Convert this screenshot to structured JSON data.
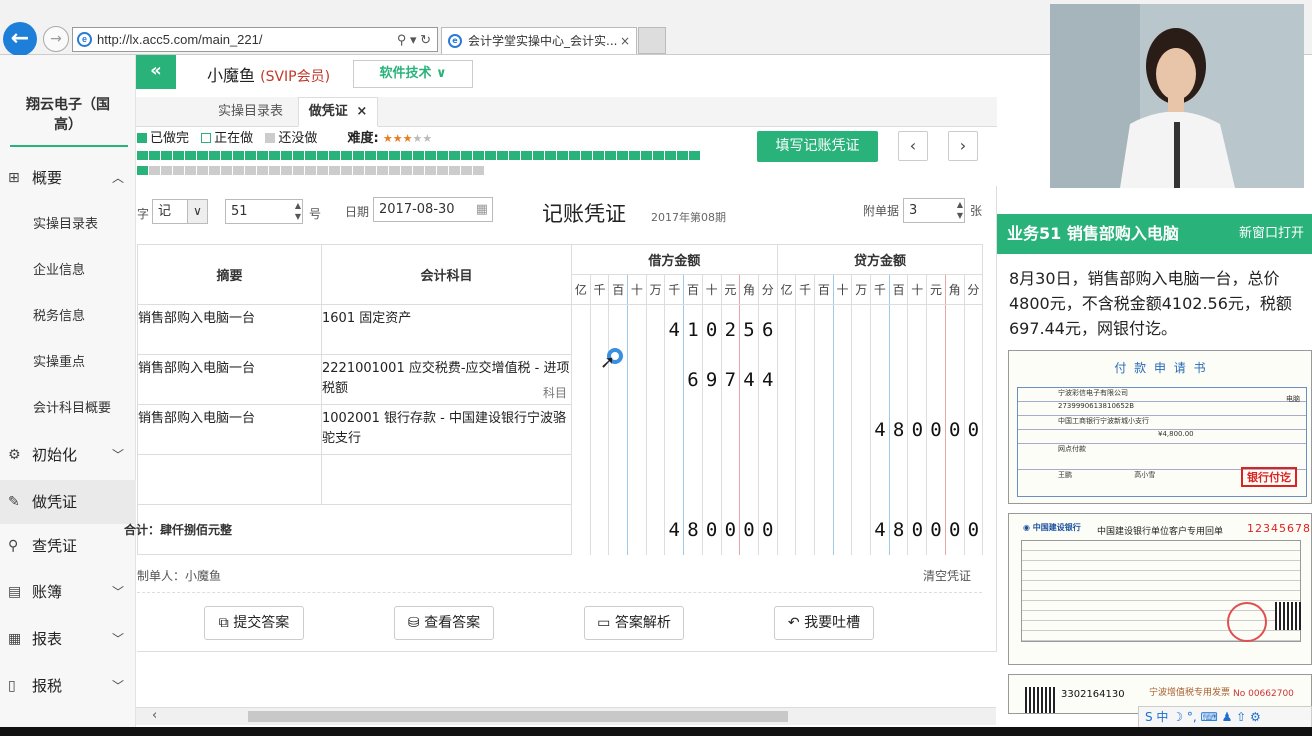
{
  "browser": {
    "url": "http://lx.acc5.com/main_221/",
    "tab_title": "会计学堂实操中心_会计实...",
    "tab_close": "×"
  },
  "sidebar": {
    "org_name": "翔云电子（国高）",
    "sections": [
      {
        "label": "概要",
        "icon": "grid-icon",
        "expanded": true,
        "items": [
          "实操目录表",
          "企业信息",
          "税务信息",
          "实操重点",
          "会计科目概要"
        ]
      },
      {
        "label": "初始化",
        "icon": "gear-icon"
      },
      {
        "label": "做凭证",
        "icon": "pencil-icon",
        "active": true
      },
      {
        "label": "查凭证",
        "icon": "search-icon"
      },
      {
        "label": "账簿",
        "icon": "book-icon"
      },
      {
        "label": "报表",
        "icon": "report-icon"
      },
      {
        "label": "报税",
        "icon": "document-icon"
      }
    ]
  },
  "header": {
    "collapse": "«",
    "username": "小魔鱼",
    "vip": "(SVIP会员)",
    "software_button": "软件技术 ∨"
  },
  "tabs": [
    {
      "label": "实操目录表"
    },
    {
      "label": "做凭证",
      "close": "×"
    }
  ],
  "legend": {
    "done": "已做完",
    "doing": "正在做",
    "todo": "还没做",
    "difficulty_label": "难度:",
    "difficulty": 3,
    "difficulty_max": 5,
    "done_color": "#2ab27b"
  },
  "progress": {
    "done_count": 48,
    "total": 76
  },
  "fill_button": "填写记账凭证",
  "prev_button": "‹",
  "next_button": "›",
  "voucher": {
    "zi_label": "字",
    "zi_value": "记",
    "number": "51",
    "hao_label": "号",
    "date_label": "日期",
    "date": "2017-08-30",
    "title": "记账凭证",
    "period": "2017年第08期",
    "attach_label": "附单据",
    "attach_count": "3",
    "attach_unit": "张",
    "col_summary": "摘要",
    "col_account": "会计科目",
    "col_debit": "借方金额",
    "col_credit": "贷方金额",
    "digit_units": [
      "亿",
      "千",
      "百",
      "十",
      "万",
      "千",
      "百",
      "十",
      "元",
      "角",
      "分"
    ],
    "rows": [
      {
        "summary": "销售部购入电脑一台",
        "account": "1601 固定资产",
        "debit": "410256",
        "credit": ""
      },
      {
        "summary": "销售部购入电脑一台",
        "account": "2221001001 应交税费-应交增值税 - 进项税额",
        "account_hint": "科目",
        "debit": "69744",
        "credit": ""
      },
      {
        "summary": "销售部购入电脑一台",
        "account": "1002001 银行存款 - 中国建设银行宁波骆驼支行",
        "debit": "",
        "credit": "480000"
      },
      {
        "summary": "",
        "account": "",
        "debit": "",
        "credit": ""
      }
    ],
    "total_label": "合计：肆仟捌佰元整",
    "total_debit": "480000",
    "total_credit": "480000",
    "maker": "制单人：小魔鱼",
    "clear": "清空凭证"
  },
  "actions": [
    {
      "icon": "external-link-icon",
      "label": "提交答案"
    },
    {
      "icon": "database-icon",
      "label": "查看答案"
    },
    {
      "icon": "folder-open-icon",
      "label": "答案解析"
    },
    {
      "icon": "reply-icon",
      "label": "我要吐槽"
    }
  ],
  "business": {
    "title": "业务51 销售部购入电脑",
    "open_new": "新窗口打开",
    "description_lines": [
      "8月30日，销售部购入电脑一台，总价",
      "4800元，不含税金额4102.56元，税额",
      "697.44元，网银付讫。"
    ],
    "doc1": {
      "title": "付 款 申 请 书",
      "stamp": "银行付讫",
      "payee": "宁波彩信电子有限公司",
      "account": "2739990613810652B",
      "bank": "中国工商银行宁波新城小支行",
      "amount": "¥4,800.00",
      "method": "网点付款",
      "item": "电脑",
      "approver": "王鹏",
      "handler": "高小雪"
    },
    "doc2": {
      "bank": "中国建设银行",
      "title": "中国建设银行单位客户专用回单",
      "serial": "12345678"
    },
    "doc3": {
      "code": "3302164130",
      "title": "宁波增值税专用发票",
      "number": "No 00662700"
    }
  },
  "ime": {
    "label": "S 中 ☽ °, ⌨ ♟ ⇧ ⚙"
  }
}
